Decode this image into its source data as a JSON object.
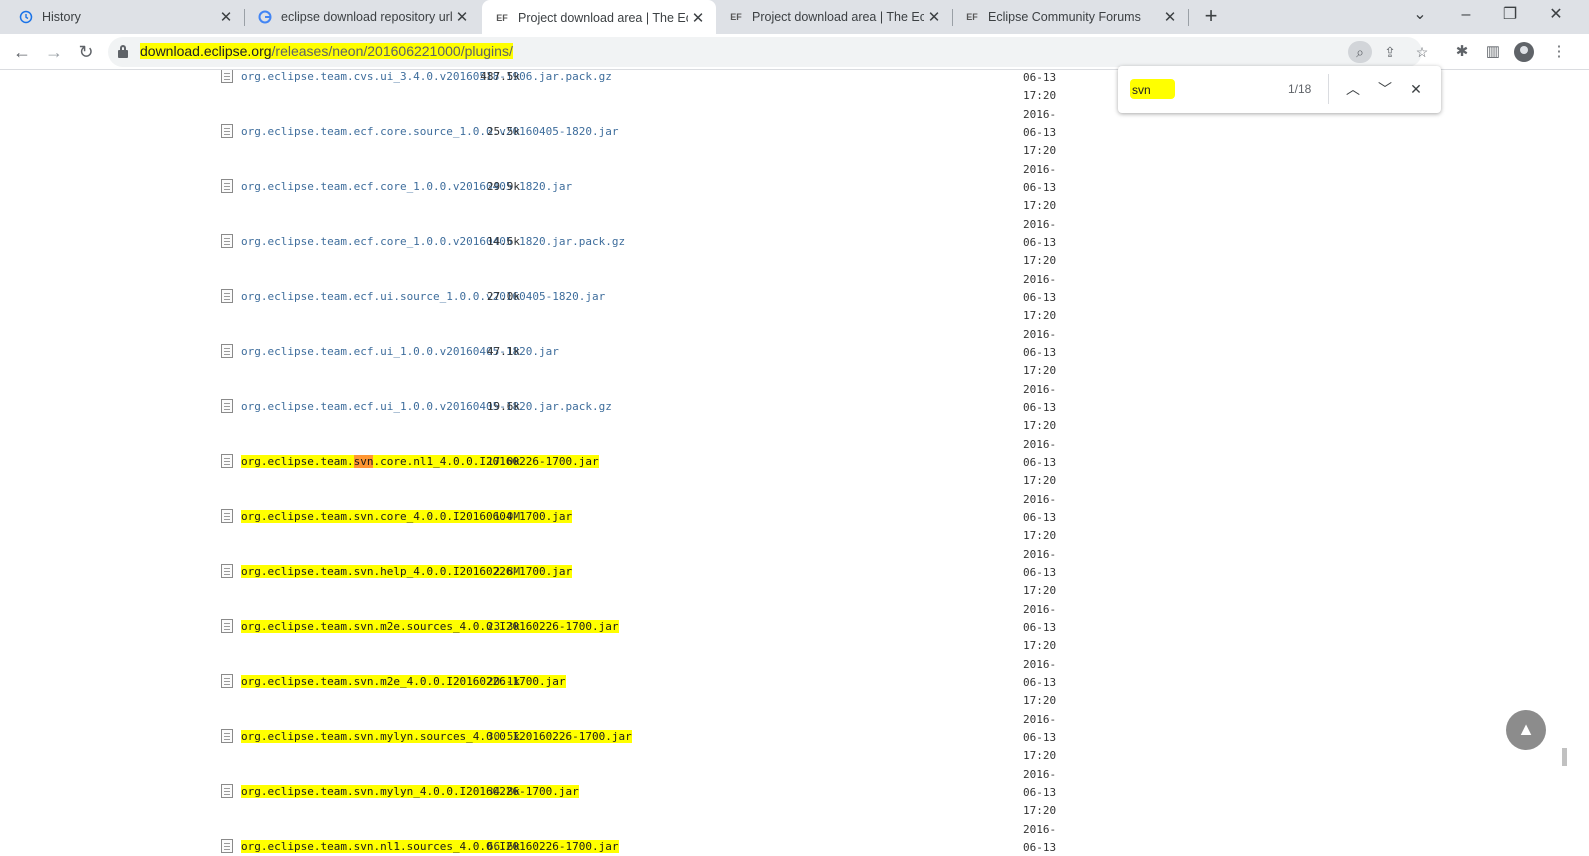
{
  "browser": {
    "tabs": [
      {
        "title": "History",
        "favicon": "history-icon",
        "active": false
      },
      {
        "title": "eclipse download repository url -",
        "favicon": "google-icon",
        "active": false
      },
      {
        "title": "Project download area | The Eclip",
        "favicon": "EF",
        "active": true
      },
      {
        "title": "Project download area | The Eclip",
        "favicon": "EF",
        "active": false
      },
      {
        "title": "Eclipse Community Forums",
        "favicon": "EF",
        "active": false
      }
    ],
    "url_host": "download.eclipse.org",
    "url_path": "/releases/neon/201606221000/plugins/"
  },
  "find": {
    "query": "svn",
    "count": "1/18"
  },
  "files": [
    {
      "pre": "org.eclipse.team.cvs.ui_3.4.0.v20160518-1906.jar.pack.gz",
      "match": "",
      "post": "",
      "size": "487.5k",
      "date_lines": [
        "06-13",
        "17:20",
        "2016-"
      ]
    },
    {
      "pre": "org.eclipse.team.ecf.core.source_1.0.0.v20160405-1820.jar",
      "match": "",
      "post": "",
      "size": "25.5k",
      "date_lines": [
        "06-13",
        "17:20",
        "2016-"
      ]
    },
    {
      "pre": "org.eclipse.team.ecf.core_1.0.0.v20160405-1820.jar",
      "match": "",
      "post": "",
      "size": "29.9k",
      "date_lines": [
        "06-13",
        "17:20",
        "2016-"
      ]
    },
    {
      "pre": "org.eclipse.team.ecf.core_1.0.0.v20160405-1820.jar.pack.gz",
      "match": "",
      "post": "",
      "size": "14.6k",
      "date_lines": [
        "06-13",
        "17:20",
        "2016-"
      ]
    },
    {
      "pre": "org.eclipse.team.ecf.ui.source_1.0.0.v20160405-1820.jar",
      "match": "",
      "post": "",
      "size": "27.0k",
      "date_lines": [
        "06-13",
        "17:20",
        "2016-"
      ]
    },
    {
      "pre": "org.eclipse.team.ecf.ui_1.0.0.v20160405-1820.jar",
      "match": "",
      "post": "",
      "size": "47.1k",
      "date_lines": [
        "06-13",
        "17:20",
        "2016-"
      ]
    },
    {
      "pre": "org.eclipse.team.ecf.ui_1.0.0.v20160405-1820.jar.pack.gz",
      "match": "",
      "post": "",
      "size": "19.6k",
      "date_lines": [
        "06-13",
        "17:20",
        "2016-"
      ]
    },
    {
      "pre": "org.eclipse.team.",
      "match": "svn",
      "post": ".core.nl1_4.0.0.I20160226-1700.jar",
      "size": "17.0k",
      "date_lines": [
        "06-13",
        "17:20",
        "2016-"
      ]
    },
    {
      "pre": "org.eclipse.team.",
      "match": "svn",
      "post": ".core_4.0.0.I20160604-1700.jar",
      "size": "1.0M",
      "date_lines": [
        "06-13",
        "17:20",
        "2016-"
      ]
    },
    {
      "pre": "org.eclipse.team.",
      "match": "svn",
      "post": ".help_4.0.0.I20160226-1700.jar",
      "size": "2.8M",
      "date_lines": [
        "06-13",
        "17:20",
        "2016-"
      ]
    },
    {
      "pre": "org.eclipse.team.",
      "match": "svn",
      "post": ".m2e.sources_4.0.0.I20160226-1700.jar",
      "size": "23.3k",
      "date_lines": [
        "06-13",
        "17:20",
        "2016-"
      ]
    },
    {
      "pre": "org.eclipse.team.",
      "match": "svn",
      "post": ".m2e_4.0.0.I20160226-1700.jar",
      "size": "20.1k",
      "date_lines": [
        "06-13",
        "17:20",
        "2016-"
      ]
    },
    {
      "pre": "org.eclipse.team.",
      "match": "svn",
      "post": ".mylyn.sources_4.0.0.I20160226-1700.jar",
      "size": "30.5k",
      "date_lines": [
        "06-13",
        "17:20",
        "2016-"
      ]
    },
    {
      "pre": "org.eclipse.team.",
      "match": "svn",
      "post": ".mylyn_4.0.0.I20160226-1700.jar",
      "size": "34.8k",
      "date_lines": [
        "06-13",
        "17:20",
        "2016-"
      ]
    },
    {
      "pre": "org.eclipse.team.",
      "match": "svn",
      "post": ".nl1.sources_4.0.0.I20160226-1700.jar",
      "size": "66.6k",
      "date_lines": [
        "06-13",
        "",
        ""
      ]
    }
  ]
}
